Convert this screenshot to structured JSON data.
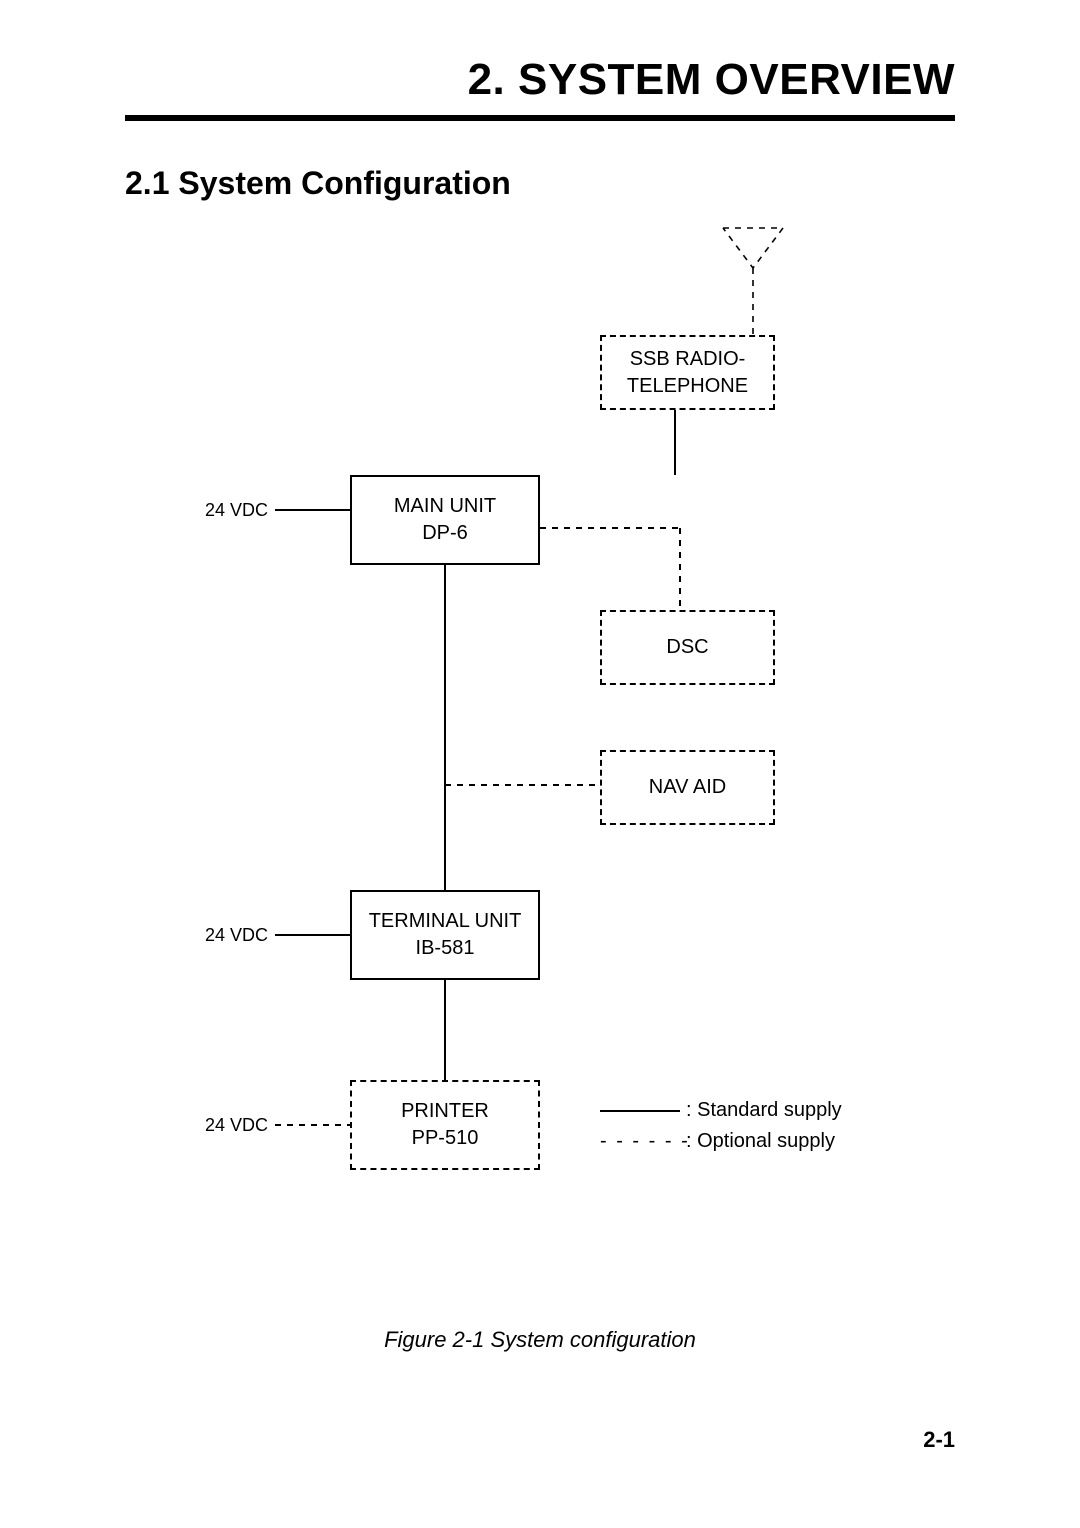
{
  "title": "2. SYSTEM OVERVIEW",
  "subheading": "2.1 System Configuration",
  "boxes": {
    "ssb": "SSB RADIO-\nTELEPHONE",
    "main": "MAIN UNIT\nDP-6",
    "dsc": "DSC",
    "navaid": "NAV AID",
    "terminal": "TERMINAL UNIT\nIB-581",
    "printer": "PRINTER\nPP-510"
  },
  "power_label": "24 VDC",
  "legend": {
    "standard": ": Standard supply",
    "optional": ": Optional supply",
    "dashes": "- - - - - -"
  },
  "caption": "Figure 2-1 System configuration",
  "page_num": "2-1"
}
